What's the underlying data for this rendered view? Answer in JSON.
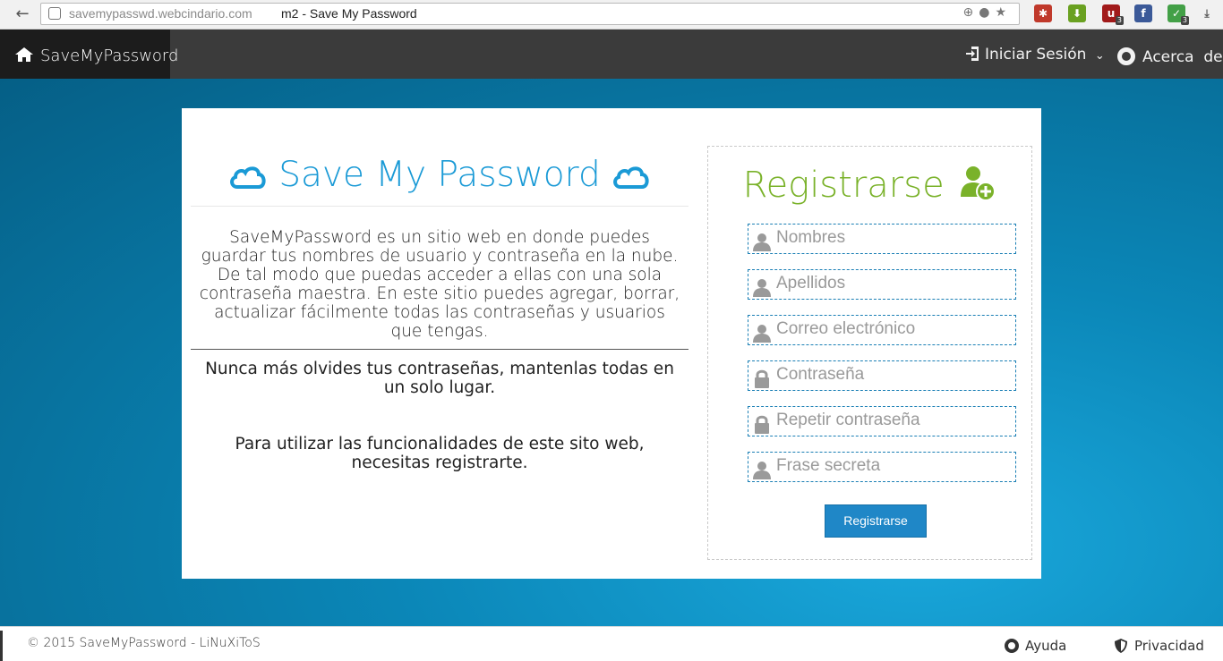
{
  "browser": {
    "url_domain": "savemypasswd.webcindario.com",
    "tab_title": "m2 - Save My Password",
    "extensions": [
      {
        "name": "bug-extension-icon",
        "color": "#c0392b",
        "badge": ""
      },
      {
        "name": "download-extension-icon",
        "color": "#6aa121",
        "badge": ""
      },
      {
        "name": "ublock-extension-icon",
        "color": "#a11a1a",
        "badge": "3"
      },
      {
        "name": "facebook-extension-icon",
        "color": "#3b5998",
        "badge": ""
      },
      {
        "name": "shield-extension-icon",
        "color": "#43a047",
        "badge": "3"
      }
    ]
  },
  "navbar": {
    "brand": "SaveMyPassword",
    "login": "Iniciar Sesión",
    "login_caret": "⌄",
    "about": "Acerca  de"
  },
  "intro": {
    "title": "Save My Password",
    "description": "SaveMyPassword es un sitio web en donde puedes guardar tus nombres de usuario y contraseña en la nube. De tal modo que puedas acceder a ellas con una sola contraseña maestra. En este sitio puedes agregar, borrar, actualizar fácilmente todas las contraseñas y usuarios que tengas.",
    "tagline": "Nunca más olvides tus contraseñas, mantenlas todas en un solo lugar.",
    "note": "Para utilizar las funcionalidades de este sito web, necesitas registrarte."
  },
  "register": {
    "title": "Registrarse",
    "fields": [
      {
        "placeholder": "Nombres",
        "icon": "user-icon"
      },
      {
        "placeholder": "Apellidos",
        "icon": "user-icon"
      },
      {
        "placeholder": "Correo electrónico",
        "icon": "user-icon"
      },
      {
        "placeholder": "Contraseña",
        "icon": "lock-icon"
      },
      {
        "placeholder": "Repetir contraseña",
        "icon": "lock-icon"
      },
      {
        "placeholder": "Frase secreta",
        "icon": "user-icon"
      }
    ],
    "submit": "Registrarse"
  },
  "footer": {
    "copyright": "© 2015 SaveMyPassword - LiNuXiToS",
    "help": "Ayuda",
    "privacy": "Privacidad"
  },
  "colors": {
    "accent_blue": "#1a9ad6",
    "register_green": "#7ab22a",
    "button_blue": "#1f87c7",
    "navbar": "#3b3b3b"
  }
}
